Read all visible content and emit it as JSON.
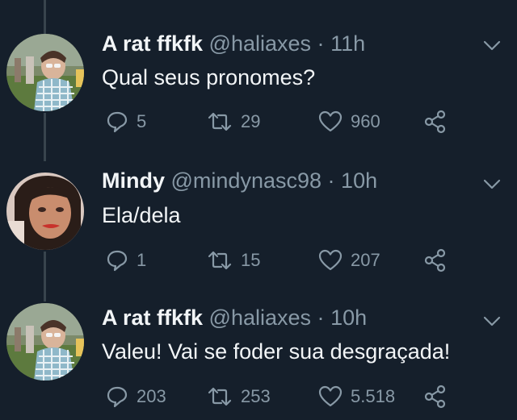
{
  "tweets": [
    {
      "name": "A rat ffkfk",
      "handle": "@haliaxes",
      "dot": "·",
      "time": "11h",
      "text": "Qual seus pronomes?",
      "replies": "5",
      "retweets": "29",
      "likes": "960"
    },
    {
      "name": "Mindy",
      "handle": "@mindynasc98",
      "dot": "·",
      "time": "10h",
      "text": "Ela/dela",
      "replies": "1",
      "retweets": "15",
      "likes": "207"
    },
    {
      "name": "A rat ffkfk",
      "handle": "@haliaxes",
      "dot": "·",
      "time": "10h",
      "text": "Valeu! Vai se foder sua desgraçada!",
      "replies": "203",
      "retweets": "253",
      "likes": "5.518"
    }
  ],
  "icons": {
    "reply": "speech-bubble-icon",
    "retweet": "retweet-arrows-icon",
    "like": "heart-outline-icon",
    "share": "share-nodes-icon",
    "menu": "chevron-down-icon"
  },
  "colors": {
    "background": "#151f2b",
    "primary_text": "#f2f5f7",
    "secondary_text": "#8899a6",
    "thread_line": "#38444d"
  }
}
